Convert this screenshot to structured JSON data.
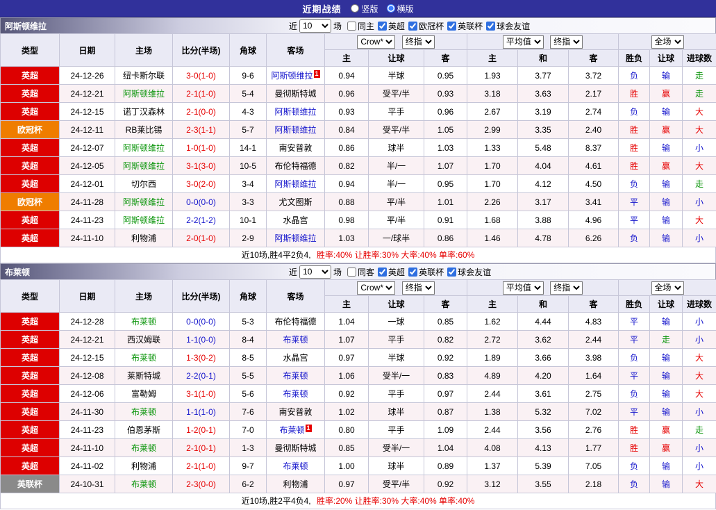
{
  "title_bar": {
    "title": "近期战绩",
    "radios": [
      {
        "label": "竖版",
        "selected": false
      },
      {
        "label": "横版",
        "selected": true
      }
    ]
  },
  "table_headers": {
    "type": "类型",
    "date": "日期",
    "home": "主场",
    "score": "比分(半场)",
    "corners": "角球",
    "away": "客场",
    "asia": [
      "主",
      "让球",
      "客"
    ],
    "europe": [
      "主",
      "和",
      "客"
    ],
    "result": [
      "胜负",
      "让球",
      "进球数"
    ]
  },
  "league_colors": {
    "英超": "#dd0000",
    "欧冠杯": "#ef7d00",
    "英联杯": "#8a8a8a"
  },
  "text_colors": {
    "red": "#e60000",
    "blue": "#1414cc",
    "green": "#089408",
    "black": "#000000"
  },
  "sections": [
    {
      "team": "阿斯顿维拉",
      "filter": {
        "near": "近",
        "count": "10",
        "unit": "场",
        "checkboxes": [
          {
            "label": "同主",
            "checked": false
          },
          {
            "label": "英超",
            "checked": true
          },
          {
            "label": "欧冠杯",
            "checked": true
          },
          {
            "label": "英联杯",
            "checked": true
          },
          {
            "label": "球会友谊",
            "checked": true
          }
        ]
      },
      "selects": {
        "asia_source": "Crow*",
        "asia_time": "终指",
        "europe_source": "平均值",
        "europe_time": "终指",
        "scope": "全场"
      },
      "rows": [
        {
          "league": "英超",
          "date": "24-12-26",
          "home": "纽卡斯尔联",
          "home_color": "black",
          "score": "3-0(1-0)",
          "score_color": "red",
          "corners": "9-6",
          "away": "阿斯顿维拉",
          "away_color": "blue",
          "away_badge": "1",
          "asia_home": "0.94",
          "handicap": "半球",
          "asia_away": "0.95",
          "euro_home": "1.93",
          "euro_draw": "3.77",
          "euro_away": "3.72",
          "wdl": "负",
          "wdl_color": "blue",
          "asia_result": "输",
          "asia_result_color": "blue",
          "goal_result": "走",
          "goal_result_color": "green"
        },
        {
          "league": "英超",
          "date": "24-12-21",
          "home": "阿斯顿维拉",
          "home_color": "green",
          "score": "2-1(1-0)",
          "score_color": "red",
          "corners": "5-4",
          "away": "曼彻斯特城",
          "away_color": "black",
          "away_badge": "",
          "asia_home": "0.96",
          "handicap": "受平/半",
          "asia_away": "0.93",
          "euro_home": "3.18",
          "euro_draw": "3.63",
          "euro_away": "2.17",
          "wdl": "胜",
          "wdl_color": "red",
          "asia_result": "赢",
          "asia_result_color": "red",
          "goal_result": "走",
          "goal_result_color": "green"
        },
        {
          "league": "英超",
          "date": "24-12-15",
          "home": "诺丁汉森林",
          "home_color": "black",
          "score": "2-1(0-0)",
          "score_color": "red",
          "corners": "4-3",
          "away": "阿斯顿维拉",
          "away_color": "blue",
          "away_badge": "",
          "asia_home": "0.93",
          "handicap": "平手",
          "asia_away": "0.96",
          "euro_home": "2.67",
          "euro_draw": "3.19",
          "euro_away": "2.74",
          "wdl": "负",
          "wdl_color": "blue",
          "asia_result": "输",
          "asia_result_color": "blue",
          "goal_result": "大",
          "goal_result_color": "red"
        },
        {
          "league": "欧冠杯",
          "date": "24-12-11",
          "home": "RB莱比锡",
          "home_color": "black",
          "score": "2-3(1-1)",
          "score_color": "red",
          "corners": "5-7",
          "away": "阿斯顿维拉",
          "away_color": "blue",
          "away_badge": "",
          "asia_home": "0.84",
          "handicap": "受平/半",
          "asia_away": "1.05",
          "euro_home": "2.99",
          "euro_draw": "3.35",
          "euro_away": "2.40",
          "wdl": "胜",
          "wdl_color": "red",
          "asia_result": "赢",
          "asia_result_color": "red",
          "goal_result": "大",
          "goal_result_color": "red"
        },
        {
          "league": "英超",
          "date": "24-12-07",
          "home": "阿斯顿维拉",
          "home_color": "green",
          "score": "1-0(1-0)",
          "score_color": "red",
          "corners": "14-1",
          "away": "南安普敦",
          "away_color": "black",
          "away_badge": "",
          "asia_home": "0.86",
          "handicap": "球半",
          "asia_away": "1.03",
          "euro_home": "1.33",
          "euro_draw": "5.48",
          "euro_away": "8.37",
          "wdl": "胜",
          "wdl_color": "red",
          "asia_result": "输",
          "asia_result_color": "blue",
          "goal_result": "小",
          "goal_result_color": "blue"
        },
        {
          "league": "英超",
          "date": "24-12-05",
          "home": "阿斯顿维拉",
          "home_color": "green",
          "score": "3-1(3-0)",
          "score_color": "red",
          "corners": "10-5",
          "away": "布伦特福德",
          "away_color": "black",
          "away_badge": "",
          "asia_home": "0.82",
          "handicap": "半/一",
          "asia_away": "1.07",
          "euro_home": "1.70",
          "euro_draw": "4.04",
          "euro_away": "4.61",
          "wdl": "胜",
          "wdl_color": "red",
          "asia_result": "赢",
          "asia_result_color": "red",
          "goal_result": "大",
          "goal_result_color": "red"
        },
        {
          "league": "英超",
          "date": "24-12-01",
          "home": "切尔西",
          "home_color": "black",
          "score": "3-0(2-0)",
          "score_color": "red",
          "corners": "3-4",
          "away": "阿斯顿维拉",
          "away_color": "blue",
          "away_badge": "",
          "asia_home": "0.94",
          "handicap": "半/一",
          "asia_away": "0.95",
          "euro_home": "1.70",
          "euro_draw": "4.12",
          "euro_away": "4.50",
          "wdl": "负",
          "wdl_color": "blue",
          "asia_result": "输",
          "asia_result_color": "blue",
          "goal_result": "走",
          "goal_result_color": "green"
        },
        {
          "league": "欧冠杯",
          "date": "24-11-28",
          "home": "阿斯顿维拉",
          "home_color": "green",
          "score": "0-0(0-0)",
          "score_color": "blue",
          "corners": "3-3",
          "away": "尤文图斯",
          "away_color": "black",
          "away_badge": "",
          "asia_home": "0.88",
          "handicap": "平/半",
          "asia_away": "1.01",
          "euro_home": "2.26",
          "euro_draw": "3.17",
          "euro_away": "3.41",
          "wdl": "平",
          "wdl_color": "blue",
          "asia_result": "输",
          "asia_result_color": "blue",
          "goal_result": "小",
          "goal_result_color": "blue"
        },
        {
          "league": "英超",
          "date": "24-11-23",
          "home": "阿斯顿维拉",
          "home_color": "green",
          "score": "2-2(1-2)",
          "score_color": "blue",
          "corners": "10-1",
          "away": "水晶宫",
          "away_color": "black",
          "away_badge": "",
          "asia_home": "0.98",
          "handicap": "平/半",
          "asia_away": "0.91",
          "euro_home": "1.68",
          "euro_draw": "3.88",
          "euro_away": "4.96",
          "wdl": "平",
          "wdl_color": "blue",
          "asia_result": "输",
          "asia_result_color": "blue",
          "goal_result": "大",
          "goal_result_color": "red"
        },
        {
          "league": "英超",
          "date": "24-11-10",
          "home": "利物浦",
          "home_color": "black",
          "score": "2-0(1-0)",
          "score_color": "red",
          "corners": "2-9",
          "away": "阿斯顿维拉",
          "away_color": "blue",
          "away_badge": "",
          "asia_home": "1.03",
          "handicap": "一/球半",
          "asia_away": "0.86",
          "euro_home": "1.46",
          "euro_draw": "4.78",
          "euro_away": "6.26",
          "wdl": "负",
          "wdl_color": "blue",
          "asia_result": "输",
          "asia_result_color": "blue",
          "goal_result": "小",
          "goal_result_color": "blue"
        }
      ],
      "summary": {
        "record": "近10场,胜4平2负4,",
        "stats": "胜率:40% 让胜率:30% 大率:40% 单率:60%"
      }
    },
    {
      "team": "布莱顿",
      "filter": {
        "near": "近",
        "count": "10",
        "unit": "场",
        "checkboxes": [
          {
            "label": "同客",
            "checked": false
          },
          {
            "label": "英超",
            "checked": true
          },
          {
            "label": "英联杯",
            "checked": true
          },
          {
            "label": "球会友谊",
            "checked": true
          }
        ]
      },
      "selects": {
        "asia_source": "Crow*",
        "asia_time": "终指",
        "europe_source": "平均值",
        "europe_time": "终指",
        "scope": "全场"
      },
      "rows": [
        {
          "league": "英超",
          "date": "24-12-28",
          "home": "布莱顿",
          "home_color": "green",
          "score": "0-0(0-0)",
          "score_color": "blue",
          "corners": "5-3",
          "away": "布伦特福德",
          "away_color": "black",
          "away_badge": "",
          "asia_home": "1.04",
          "handicap": "一球",
          "asia_away": "0.85",
          "euro_home": "1.62",
          "euro_draw": "4.44",
          "euro_away": "4.83",
          "wdl": "平",
          "wdl_color": "blue",
          "asia_result": "输",
          "asia_result_color": "blue",
          "goal_result": "小",
          "goal_result_color": "blue"
        },
        {
          "league": "英超",
          "date": "24-12-21",
          "home": "西汉姆联",
          "home_color": "black",
          "score": "1-1(0-0)",
          "score_color": "blue",
          "corners": "8-4",
          "away": "布莱顿",
          "away_color": "blue",
          "away_badge": "",
          "asia_home": "1.07",
          "handicap": "平手",
          "asia_away": "0.82",
          "euro_home": "2.72",
          "euro_draw": "3.62",
          "euro_away": "2.44",
          "wdl": "平",
          "wdl_color": "blue",
          "asia_result": "走",
          "asia_result_color": "green",
          "goal_result": "小",
          "goal_result_color": "blue"
        },
        {
          "league": "英超",
          "date": "24-12-15",
          "home": "布莱顿",
          "home_color": "green",
          "score": "1-3(0-2)",
          "score_color": "red",
          "corners": "8-5",
          "away": "水晶宫",
          "away_color": "black",
          "away_badge": "",
          "asia_home": "0.97",
          "handicap": "半球",
          "asia_away": "0.92",
          "euro_home": "1.89",
          "euro_draw": "3.66",
          "euro_away": "3.98",
          "wdl": "负",
          "wdl_color": "blue",
          "asia_result": "输",
          "asia_result_color": "blue",
          "goal_result": "大",
          "goal_result_color": "red"
        },
        {
          "league": "英超",
          "date": "24-12-08",
          "home": "莱斯特城",
          "home_color": "black",
          "score": "2-2(0-1)",
          "score_color": "blue",
          "corners": "5-5",
          "away": "布莱顿",
          "away_color": "blue",
          "away_badge": "",
          "asia_home": "1.06",
          "handicap": "受半/一",
          "asia_away": "0.83",
          "euro_home": "4.89",
          "euro_draw": "4.20",
          "euro_away": "1.64",
          "wdl": "平",
          "wdl_color": "blue",
          "asia_result": "输",
          "asia_result_color": "blue",
          "goal_result": "大",
          "goal_result_color": "red"
        },
        {
          "league": "英超",
          "date": "24-12-06",
          "home": "富勒姆",
          "home_color": "black",
          "score": "3-1(1-0)",
          "score_color": "red",
          "corners": "5-6",
          "away": "布莱顿",
          "away_color": "blue",
          "away_badge": "",
          "asia_home": "0.92",
          "handicap": "平手",
          "asia_away": "0.97",
          "euro_home": "2.44",
          "euro_draw": "3.61",
          "euro_away": "2.75",
          "wdl": "负",
          "wdl_color": "blue",
          "asia_result": "输",
          "asia_result_color": "blue",
          "goal_result": "大",
          "goal_result_color": "red"
        },
        {
          "league": "英超",
          "date": "24-11-30",
          "home": "布莱顿",
          "home_color": "green",
          "score": "1-1(1-0)",
          "score_color": "blue",
          "corners": "7-6",
          "away": "南安普敦",
          "away_color": "black",
          "away_badge": "",
          "asia_home": "1.02",
          "handicap": "球半",
          "asia_away": "0.87",
          "euro_home": "1.38",
          "euro_draw": "5.32",
          "euro_away": "7.02",
          "wdl": "平",
          "wdl_color": "blue",
          "asia_result": "输",
          "asia_result_color": "blue",
          "goal_result": "小",
          "goal_result_color": "blue"
        },
        {
          "league": "英超",
          "date": "24-11-23",
          "home": "伯恩茅斯",
          "home_color": "black",
          "score": "1-2(0-1)",
          "score_color": "red",
          "corners": "7-0",
          "away": "布莱顿",
          "away_color": "blue",
          "away_badge": "1",
          "asia_home": "0.80",
          "handicap": "平手",
          "asia_away": "1.09",
          "euro_home": "2.44",
          "euro_draw": "3.56",
          "euro_away": "2.76",
          "wdl": "胜",
          "wdl_color": "red",
          "asia_result": "赢",
          "asia_result_color": "red",
          "goal_result": "走",
          "goal_result_color": "green"
        },
        {
          "league": "英超",
          "date": "24-11-10",
          "home": "布莱顿",
          "home_color": "green",
          "score": "2-1(0-1)",
          "score_color": "red",
          "corners": "1-3",
          "away": "曼彻斯特城",
          "away_color": "black",
          "away_badge": "",
          "asia_home": "0.85",
          "handicap": "受半/一",
          "asia_away": "1.04",
          "euro_home": "4.08",
          "euro_draw": "4.13",
          "euro_away": "1.77",
          "wdl": "胜",
          "wdl_color": "red",
          "asia_result": "赢",
          "asia_result_color": "red",
          "goal_result": "小",
          "goal_result_color": "blue"
        },
        {
          "league": "英超",
          "date": "24-11-02",
          "home": "利物浦",
          "home_color": "black",
          "score": "2-1(1-0)",
          "score_color": "red",
          "corners": "9-7",
          "away": "布莱顿",
          "away_color": "blue",
          "away_badge": "",
          "asia_home": "1.00",
          "handicap": "球半",
          "asia_away": "0.89",
          "euro_home": "1.37",
          "euro_draw": "5.39",
          "euro_away": "7.05",
          "wdl": "负",
          "wdl_color": "blue",
          "asia_result": "输",
          "asia_result_color": "blue",
          "goal_result": "小",
          "goal_result_color": "blue"
        },
        {
          "league": "英联杯",
          "date": "24-10-31",
          "home": "布莱顿",
          "home_color": "green",
          "score": "2-3(0-0)",
          "score_color": "red",
          "corners": "6-2",
          "away": "利物浦",
          "away_color": "black",
          "away_badge": "",
          "asia_home": "0.97",
          "handicap": "受平/半",
          "asia_away": "0.92",
          "euro_home": "3.12",
          "euro_draw": "3.55",
          "euro_away": "2.18",
          "wdl": "负",
          "wdl_color": "blue",
          "asia_result": "输",
          "asia_result_color": "blue",
          "goal_result": "大",
          "goal_result_color": "red"
        }
      ],
      "summary": {
        "record": "近10场,胜2平4负4,",
        "stats": "胜率:20% 让胜率:30% 大率:40% 单率:40%"
      }
    }
  ]
}
